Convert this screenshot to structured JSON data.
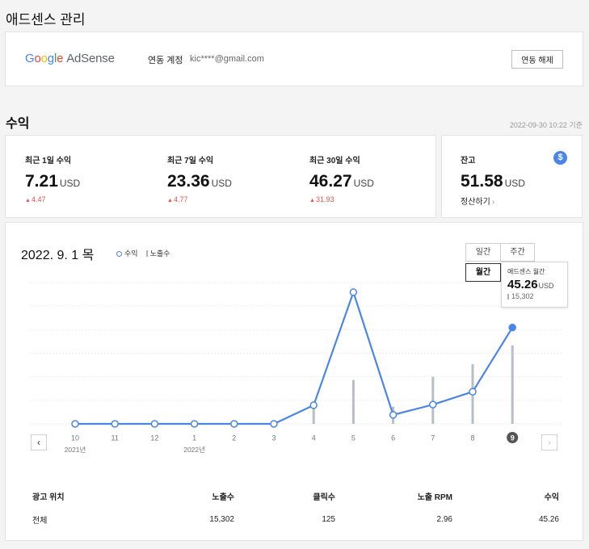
{
  "page_title": "애드센스 관리",
  "account": {
    "logo": {
      "letters": [
        "G",
        "o",
        "o",
        "g",
        "l",
        "e"
      ],
      "suffix": "AdSense"
    },
    "label": "연동 계정",
    "email": "kic****@gmail.com",
    "unlink_label": "연동 해제"
  },
  "earnings": {
    "title": "수익",
    "as_of": "2022-09-30 10:22 기준",
    "stats": [
      {
        "label": "최근 1일 수익",
        "value": "7.21",
        "unit": "USD",
        "delta": "4.47",
        "direction": "up"
      },
      {
        "label": "최근 7일 수익",
        "value": "23.36",
        "unit": "USD",
        "delta": "4.77",
        "direction": "up"
      },
      {
        "label": "최근 30일 수익",
        "value": "46.27",
        "unit": "USD",
        "delta": "31.93",
        "direction": "up"
      }
    ],
    "balance": {
      "label": "잔고",
      "value": "51.58",
      "unit": "USD",
      "settle_label": "정산하기",
      "icon": "dollar-icon"
    }
  },
  "chart_panel": {
    "date_label": "2022. 9. 1 목",
    "legend": {
      "revenue": "수익",
      "impressions": "노출수"
    },
    "periods": {
      "daily": "일간",
      "weekly": "주간",
      "monthly": "월간"
    },
    "selected_period": "monthly",
    "tooltip": {
      "label": "애드센스 월간",
      "value": "45.26",
      "unit": "USD",
      "impressions": "15,302"
    },
    "nav": {
      "prev": "‹",
      "next": "›"
    }
  },
  "chart_data": {
    "type": "line",
    "categories": [
      "10",
      "11",
      "12",
      "1",
      "2",
      "3",
      "4",
      "5",
      "6",
      "7",
      "8",
      "9"
    ],
    "year_labels": [
      {
        "index": 0,
        "text": "2021년"
      },
      {
        "index": 3,
        "text": "2022년"
      }
    ],
    "selected_index": 11,
    "series": [
      {
        "name": "수익",
        "type": "line",
        "values": [
          0,
          0,
          0,
          0,
          0,
          0,
          1.45,
          10.25,
          0.7,
          1.5,
          2.5,
          7.5
        ]
      },
      {
        "name": "노출수",
        "type": "bar",
        "values": [
          0,
          0,
          0,
          0,
          0,
          0,
          1100,
          2800,
          1100,
          3000,
          3800,
          5000
        ]
      }
    ],
    "revenue_max": 11,
    "impressions_max": 9000,
    "grid": true,
    "colors": {
      "line": "#4a86e8",
      "bar": "#b8bec6",
      "selected_tick": "#555555"
    }
  },
  "table": {
    "headers": [
      "광고 위치",
      "노출수",
      "클릭수",
      "노출 RPM",
      "수익"
    ],
    "rows": [
      [
        "전체",
        "15,302",
        "125",
        "2.96",
        "45.26"
      ]
    ]
  }
}
